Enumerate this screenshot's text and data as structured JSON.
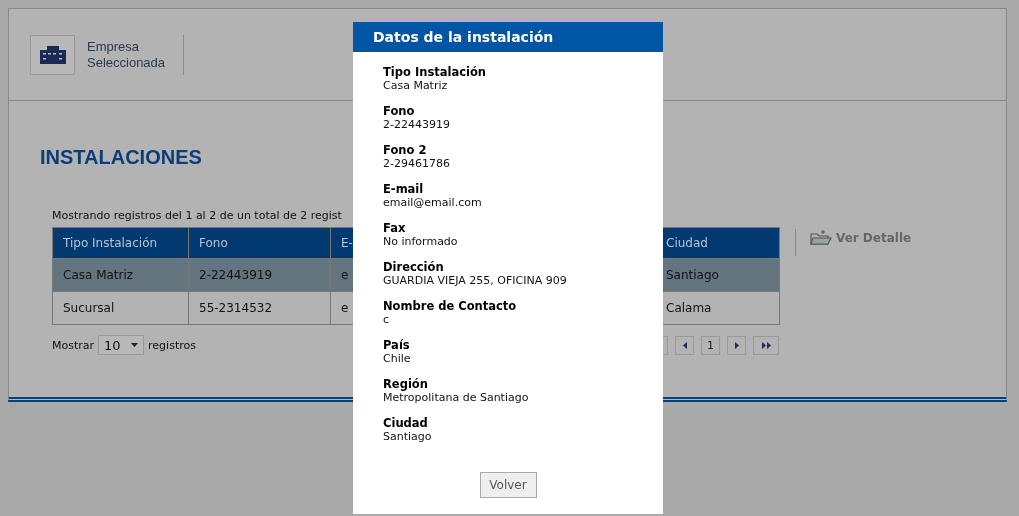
{
  "company": {
    "label_line1": "Empresa",
    "label_line2": "Seleccionada"
  },
  "page_title": "INSTALACIONES",
  "info": "Mostrando registros del 1 al 2 de un total de 2 regist",
  "table": {
    "columns": [
      "Tipo Instalación",
      "Fono",
      "E-",
      "Ciudad"
    ],
    "rows": [
      {
        "cells": [
          "Casa Matriz",
          "2-22443919",
          "e",
          "Santiago"
        ],
        "selected": true
      },
      {
        "cells": [
          "Sucursal",
          "55-2314532",
          "e",
          "Calama"
        ],
        "selected": false
      }
    ]
  },
  "page_size": {
    "before": "Mostrar",
    "value": "10",
    "after": "registros"
  },
  "pagination": [
    {
      "kind": "first"
    },
    {
      "kind": "prev"
    },
    {
      "kind": "page",
      "label": "1"
    },
    {
      "kind": "next"
    },
    {
      "kind": "last"
    }
  ],
  "detail_action": "Ver Detalle",
  "modal": {
    "title": "Datos de la instalación",
    "fields": [
      {
        "label": "Tipo Instalación",
        "value": "Casa Matriz"
      },
      {
        "label": "Fono",
        "value": "2-22443919"
      },
      {
        "label": "Fono 2",
        "value": "2-29461786"
      },
      {
        "label": "E-mail",
        "value": "email@email.com"
      },
      {
        "label": "Fax",
        "value": "No informado"
      },
      {
        "label": "Dirección",
        "value": "GUARDIA VIEJA 255, OFICINA 909"
      },
      {
        "label": "Nombre de Contacto",
        "value": "c"
      },
      {
        "label": "País",
        "value": "Chile"
      },
      {
        "label": "Región",
        "value": "Metropolitana de Santiago"
      },
      {
        "label": "Ciudad",
        "value": "Santiago"
      }
    ],
    "button": "Volver"
  }
}
